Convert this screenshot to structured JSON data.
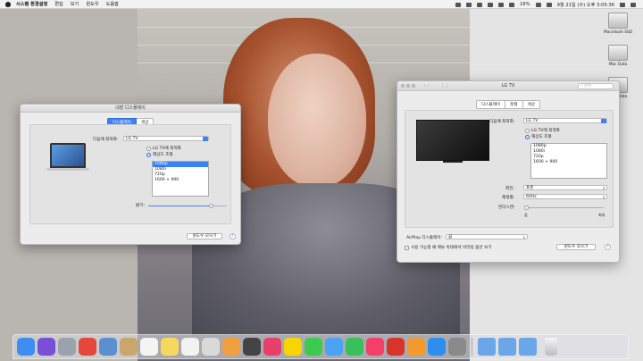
{
  "menubar": {
    "app_name": "시스템 환경설정",
    "items": [
      "편집",
      "보기",
      "윈도우",
      "도움말"
    ],
    "battery": "16%",
    "clock": "9월 21일 (수) 오후 3:05:36"
  },
  "desktop_icons": [
    {
      "label": "Macintosh SSD"
    },
    {
      "label": "Mac Data"
    },
    {
      "label": "Mac Data"
    }
  ],
  "builtin_window": {
    "title": "내장 디스플레이",
    "tabs": [
      "디스플레이",
      "색상"
    ],
    "optimize_label": "다음에 최적화:",
    "optimize_value": "LG TV",
    "radio_optimized": "LG TV에 최적화",
    "radio_scaled": "해상도 조절",
    "resolutions": [
      "1080p",
      "1080i",
      "720p",
      "1600 × 900"
    ],
    "brightness_label": "밝기:",
    "brightness_level": 0.8,
    "gather_button": "윈도우 모으기",
    "help": "?"
  },
  "lgtv_window": {
    "title": "LG TV",
    "search_placeholder": "검색",
    "tabs": [
      "디스플레이",
      "정렬",
      "색상"
    ],
    "optimize_label": "다음에 최적화:",
    "optimize_value": "LG TV",
    "radio_optimized": "LG TV에 최적화",
    "radio_scaled": "해상도 조절",
    "resolutions": [
      "1080p",
      "1080i",
      "720p",
      "1600 × 900"
    ],
    "rotation_label": "회전:",
    "rotation_value": "표준",
    "refresh_label": "재생률:",
    "refresh_value": "60Hz",
    "underscan_label": "언더스캔:",
    "underscan_min": "끔",
    "underscan_max": "최대",
    "underscan_level": 0,
    "airplay_label": "AirPlay 디스플레이:",
    "airplay_value": "끔",
    "mirror_checkbox": "사용 가능할 때 메뉴 막대에서 미러링 옵션 보기",
    "gather_button": "윈도우 모으기",
    "help": "?"
  },
  "dock": {
    "apps": [
      {
        "name": "finder-icon",
        "color": "#3d8ef0"
      },
      {
        "name": "siri-icon",
        "color": "#7a4fd8"
      },
      {
        "name": "launchpad-icon",
        "color": "#9aa3ad"
      },
      {
        "name": "chrome-icon",
        "color": "#e5483b"
      },
      {
        "name": "preview-icon",
        "color": "#5a8fd1"
      },
      {
        "name": "contacts-icon",
        "color": "#c9a66b"
      },
      {
        "name": "calendar-icon",
        "color": "#f4f4f4"
      },
      {
        "name": "notes-icon",
        "color": "#f6d85c"
      },
      {
        "name": "reminders-icon",
        "color": "#f2f2f2"
      },
      {
        "name": "keynote-icon",
        "color": "#d9d9d9"
      },
      {
        "name": "photos-icon",
        "color": "#f0a040"
      },
      {
        "name": "movie-icon",
        "color": "#444444"
      },
      {
        "name": "camera-icon",
        "color": "#e93f6b"
      },
      {
        "name": "kakaotalk-icon",
        "color": "#f7d600"
      },
      {
        "name": "line-icon",
        "color": "#3ccb4e"
      },
      {
        "name": "messages-icon",
        "color": "#4aa3f4"
      },
      {
        "name": "facetime-icon",
        "color": "#38c15b"
      },
      {
        "name": "itunes-icon",
        "color": "#f43f6a"
      },
      {
        "name": "netease-icon",
        "color": "#d8342c"
      },
      {
        "name": "ibooks-icon",
        "color": "#f29a2e"
      },
      {
        "name": "appstore-icon",
        "color": "#2e8ef0"
      },
      {
        "name": "system-preferences-icon",
        "color": "#8a8a8a"
      }
    ],
    "folders": [
      {
        "name": "applications-folder-icon",
        "color": "#6aa6e8"
      },
      {
        "name": "documents-folder-icon",
        "color": "#6aa6e8"
      },
      {
        "name": "downloads-folder-icon",
        "color": "#6aa6e8"
      }
    ]
  }
}
